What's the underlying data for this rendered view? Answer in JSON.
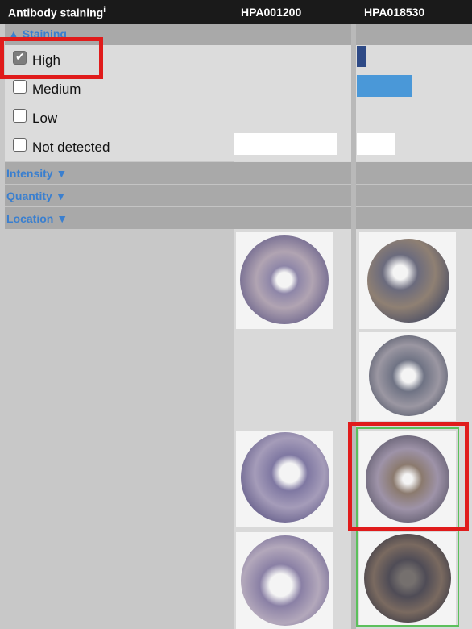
{
  "header": {
    "title": "Antibody staining",
    "info_mark": "i",
    "antibody1": "HPA001200",
    "antibody2": "HPA018530"
  },
  "filters": {
    "staining_toggle": "▲ Staining",
    "options": [
      {
        "label": "High",
        "checked": true
      },
      {
        "label": "Medium",
        "checked": false
      },
      {
        "label": "Low",
        "checked": false
      },
      {
        "label": "Not detected",
        "checked": false
      }
    ],
    "intensity": "Intensity ▼",
    "quantity": "Quantity ▼",
    "location": "Location ▼"
  },
  "staining_levels": {
    "HPA018530": {
      "high": 0.1,
      "medium": 0.48,
      "not_detected": 0.33
    },
    "HPA001200": {
      "not_detected": 0.87
    }
  },
  "colors": {
    "high_bar": "#2e4a86",
    "medium_bar": "#4a98d8",
    "link": "#3a7fcf",
    "highlight_red": "#e01b1b",
    "highlight_green": "#5cc05c"
  }
}
